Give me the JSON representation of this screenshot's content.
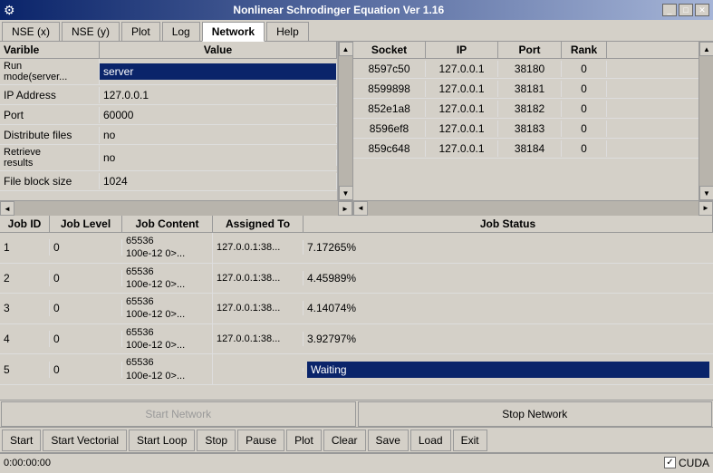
{
  "window": {
    "title": "Nonlinear Schrodinger Equation Ver 1.16",
    "icon": "⚙"
  },
  "titlebar": {
    "minimize_label": "_",
    "maximize_label": "□",
    "close_label": "✕"
  },
  "menu": {
    "tabs": [
      {
        "label": "NSE (x)",
        "active": false
      },
      {
        "label": "NSE (y)",
        "active": false
      },
      {
        "label": "Plot",
        "active": false
      },
      {
        "label": "Log",
        "active": false
      },
      {
        "label": "Network",
        "active": true
      },
      {
        "label": "Help",
        "active": false
      }
    ]
  },
  "variables": {
    "col1_header": "Varible",
    "col2_header": "Value",
    "rows": [
      {
        "name": "Run mode(server...",
        "value": "server",
        "selected": true
      },
      {
        "name": "IP Address",
        "value": "127.0.0.1",
        "selected": false
      },
      {
        "name": "Port",
        "value": "60000",
        "selected": false
      },
      {
        "name": "Distribute files",
        "value": "no",
        "selected": false
      },
      {
        "name": "Retrieve results",
        "value": "no",
        "selected": false
      },
      {
        "name": "File block size",
        "value": "1024",
        "selected": false
      }
    ]
  },
  "sockets": {
    "headers": [
      "Socket",
      "IP",
      "Port",
      "Rank"
    ],
    "rows": [
      {
        "socket": "8597c50",
        "ip": "127.0.0.1",
        "port": "38180",
        "rank": "0"
      },
      {
        "socket": "8599898",
        "ip": "127.0.0.1",
        "port": "38181",
        "rank": "0"
      },
      {
        "socket": "852e1a8",
        "ip": "127.0.0.1",
        "port": "38182",
        "rank": "0"
      },
      {
        "socket": "8596ef8",
        "ip": "127.0.0.1",
        "port": "38183",
        "rank": "0"
      },
      {
        "socket": "859c648",
        "ip": "127.0.0.1",
        "port": "38184",
        "rank": "0"
      }
    ]
  },
  "jobs": {
    "headers": [
      "Job ID",
      "Job Level",
      "Job Content",
      "Assigned To",
      "Job Status"
    ],
    "rows": [
      {
        "id": "1",
        "level": "0",
        "content": "65536\n100e-12 0>...",
        "assigned": "127.0.0.1:38...",
        "status": "7.17265%",
        "waiting": false
      },
      {
        "id": "2",
        "level": "0",
        "content": "65536\n100e-12 0>...",
        "assigned": "127.0.0.1:38...",
        "status": "4.45989%",
        "waiting": false
      },
      {
        "id": "3",
        "level": "0",
        "content": "65536\n100e-12 0>...",
        "assigned": "127.0.0.1:38...",
        "status": "4.14074%",
        "waiting": false
      },
      {
        "id": "4",
        "level": "0",
        "content": "65536\n100e-12 0>...",
        "assigned": "127.0.0.1:38...",
        "status": "3.92797%",
        "waiting": false
      },
      {
        "id": "5",
        "level": "0",
        "content": "65536\n100e-12 0>...",
        "assigned": "",
        "status": "Waiting",
        "waiting": true
      }
    ]
  },
  "network_bar": {
    "start_label": "Start Network",
    "stop_label": "Stop Network"
  },
  "toolbar": {
    "buttons": [
      "Start",
      "Start Vectorial",
      "Start Loop",
      "Stop",
      "Pause",
      "Plot",
      "Clear",
      "Save",
      "Load",
      "Exit"
    ]
  },
  "status": {
    "time": "0:00:00:00",
    "cuda_label": "CUDA",
    "cuda_checked": true
  }
}
